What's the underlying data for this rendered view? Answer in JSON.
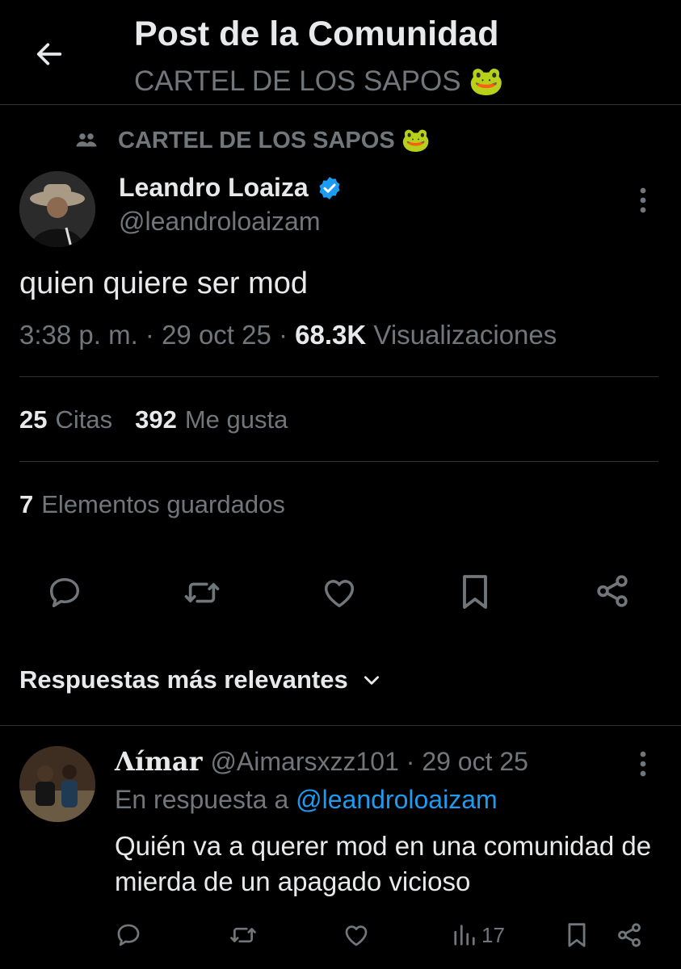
{
  "header": {
    "title": "Post de la Comunidad",
    "subtitle": "CARTEL DE LOS SAPOS 🐸"
  },
  "community": {
    "label": "CARTEL DE LOS SAPOS 🐸"
  },
  "post": {
    "author_name": "Leandro Loaiza",
    "author_handle": "@leandroloaizam",
    "text": "quien quiere ser mod",
    "time": "3:38 p. m. · 29 oct 25 · ",
    "views_count": "68.3K",
    "views_label": " Visualizaciones",
    "quotes_count": "25",
    "quotes_label": "Citas",
    "likes_count": "392",
    "likes_label": "Me gusta",
    "bookmarks_count": "7",
    "bookmarks_label": "Elementos guardados"
  },
  "replies_sort": {
    "label": "Respuestas más relevantes"
  },
  "reply": {
    "name": "Ʌímar",
    "handle_date": "@Aimarsxzz101 · 29 oct 25",
    "in_reply_prefix": "En respuesta a ",
    "in_reply_mention": "@leandroloaizam",
    "text": "Quién va a querer mod en una comunidad de mierda de un apagado vicioso",
    "views": "17"
  },
  "colors": {
    "background": "#000000",
    "text_primary": "#e7e9ea",
    "text_secondary": "#71767b",
    "accent": "#1d9bf0",
    "divider": "#2f3336"
  }
}
